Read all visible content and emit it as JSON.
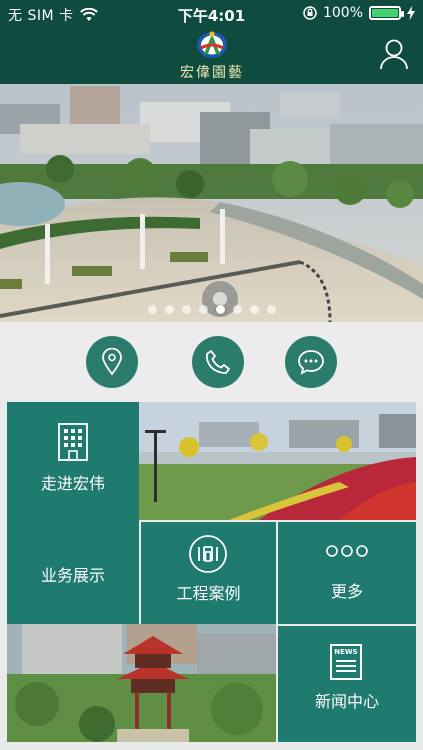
{
  "status_bar": {
    "carrier": "无 SIM 卡",
    "time": "下午4:01",
    "battery_pct": "100%"
  },
  "header": {
    "brand_name": "宏偉園藝"
  },
  "banner": {
    "slide_count": 8,
    "active_index": 4
  },
  "quick_actions": [
    {
      "name": "location",
      "icon": "location-pin-icon"
    },
    {
      "name": "phone",
      "icon": "phone-icon"
    },
    {
      "name": "message",
      "icon": "chat-bubble-icon"
    }
  ],
  "tiles": {
    "about": "走进宏伟",
    "business": "业务展示",
    "cases": "工程案例",
    "more": "更多",
    "news": "新闻中心",
    "news_badge": "NEWS"
  },
  "colors": {
    "header_bg": "#0f4c3f",
    "tile_green": "#1f7a6f",
    "circle_green": "#2c7c6e",
    "battery_green": "#43d36e"
  }
}
